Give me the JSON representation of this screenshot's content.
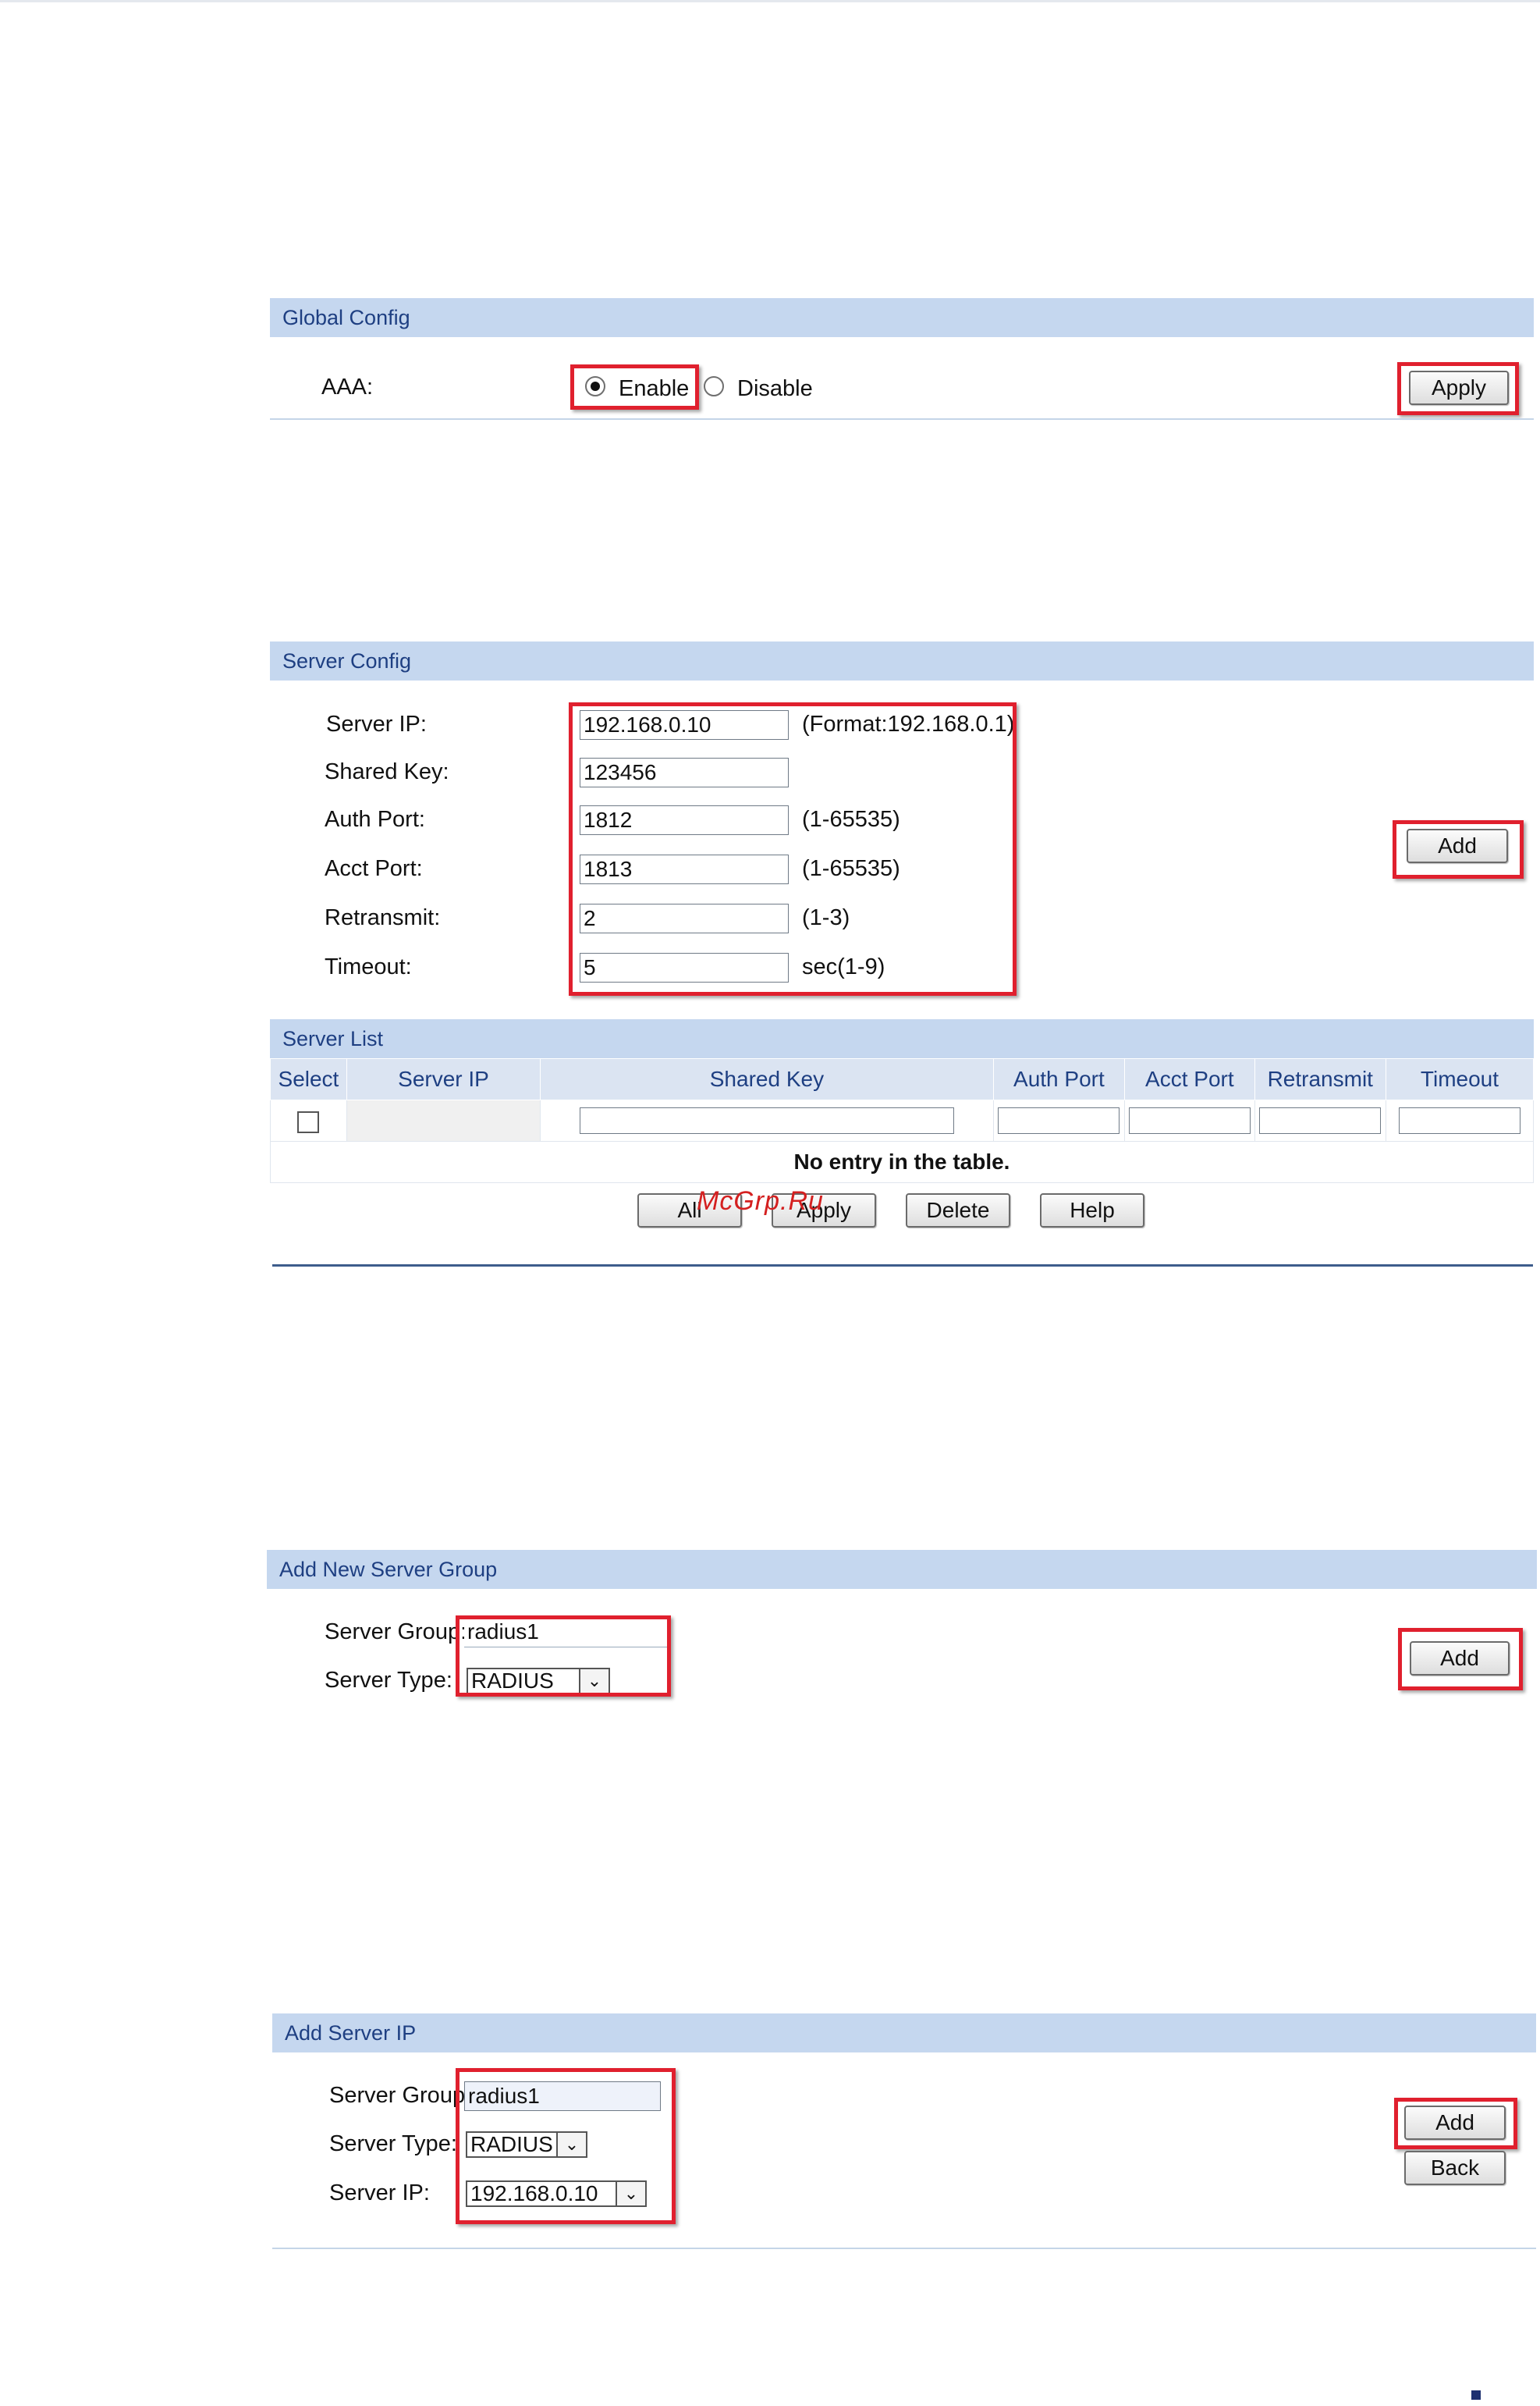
{
  "global_config": {
    "title": "Global Config",
    "aaa_label": "AAA:",
    "enable_label": "Enable",
    "disable_label": "Disable",
    "aaa_value": "Enable",
    "apply_label": "Apply"
  },
  "server_config": {
    "title": "Server Config",
    "fields": [
      {
        "label": "Server IP:",
        "value": "192.168.0.10",
        "hint": "(Format:192.168.0.1)"
      },
      {
        "label": "Shared Key:",
        "value": "123456",
        "hint": ""
      },
      {
        "label": "Auth Port:",
        "value": "1812",
        "hint": "(1-65535)"
      },
      {
        "label": "Acct Port:",
        "value": "1813",
        "hint": "(1-65535)"
      },
      {
        "label": "Retransmit:",
        "value": "2",
        "hint": "(1-3)"
      },
      {
        "label": "Timeout:",
        "value": "5",
        "hint": "sec(1-9)"
      }
    ],
    "add_label": "Add"
  },
  "server_list": {
    "title": "Server List",
    "columns": [
      "Select",
      "Server IP",
      "Shared Key",
      "Auth Port",
      "Acct Port",
      "Retransmit",
      "Timeout"
    ],
    "empty_text": "No entry in the table.",
    "buttons": {
      "all": "All",
      "apply": "Apply",
      "delete": "Delete",
      "help": "Help"
    }
  },
  "watermark": "McGrp.Ru",
  "add_new_server_group": {
    "title": "Add New Server Group",
    "group_label": "Server Group:",
    "group_value": "radius1",
    "type_label": "Server Type:",
    "type_value": "RADIUS",
    "add_label": "Add"
  },
  "add_server_ip": {
    "title": "Add Server IP",
    "group_label": "Server Group:",
    "group_value": "radius1",
    "type_label": "Server Type:",
    "type_value": "RADIUS",
    "ip_label": "Server IP:",
    "ip_value": "192.168.0.10",
    "add_label": "Add",
    "back_label": "Back"
  },
  "colors": {
    "header_bg": "#c5d7ef",
    "header_text": "#1e3f82",
    "highlight": "#e0202e"
  }
}
